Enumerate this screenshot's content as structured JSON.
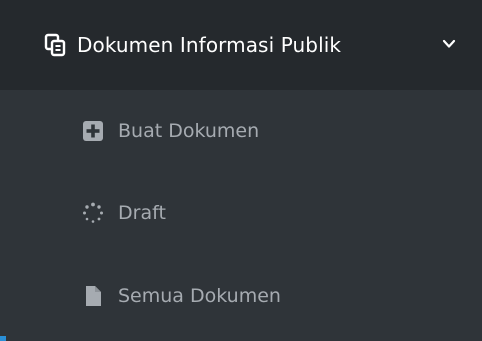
{
  "menu": {
    "title": "Dokumen Informasi Publik",
    "header_icon": "copy-documents-icon",
    "toggle_icon": "chevron-down-icon",
    "expanded": true,
    "items": [
      {
        "label": "Buat Dokumen",
        "icon": "plus-square-icon"
      },
      {
        "label": "Draft",
        "icon": "spinner-icon"
      },
      {
        "label": "Semua Dokumen",
        "icon": "file-icon"
      }
    ]
  },
  "colors": {
    "header_bg": "#25292d",
    "submenu_bg": "#2f3439",
    "header_text": "#ffffff",
    "item_text": "#a6abb1",
    "accent": "#2a8fd6"
  }
}
